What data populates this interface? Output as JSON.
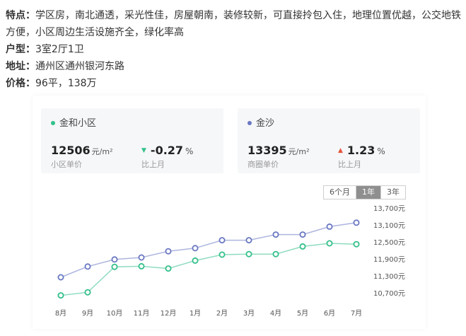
{
  "info": {
    "features_key": "特点：",
    "features_value": "学区房，南北通透，采光性佳，房屋朝南，装修较新，可直接拎包入住，地理位置优越，公交地铁方便，小区周边生活设施齐全，绿化率高",
    "layout_key": "户型：",
    "layout_value": "3室2厅1卫",
    "address_key": "地址：",
    "address_value": "通州区通州银河东路",
    "price_key": "价格：",
    "price_value": "96平，138万"
  },
  "colors": {
    "community": "#33c08a",
    "district": "#6a78c2",
    "down": "#33c08a",
    "up": "#e4553c"
  },
  "community_card": {
    "name": "金和小区",
    "price": "12506",
    "unit": "元/m²",
    "price_label": "小区单价",
    "change_value": "-0.27",
    "change_unit": "%",
    "change_label": "比上月",
    "arrow": "▼"
  },
  "district_card": {
    "name": "金沙",
    "price": "13395",
    "unit": "元/m²",
    "price_label": "商圈单价",
    "change_value": "1.23",
    "change_unit": "%",
    "change_label": "比上月",
    "arrow": "▲"
  },
  "tabs": [
    {
      "label": "6个月",
      "active": false
    },
    {
      "label": "1年",
      "active": true
    },
    {
      "label": "3年",
      "active": false
    }
  ],
  "chart_data": {
    "type": "line",
    "categories": [
      "8月",
      "9月",
      "10月",
      "11月",
      "12月",
      "1月",
      "2月",
      "3月",
      "4月",
      "5月",
      "6月",
      "7月"
    ],
    "ylim": [
      10400,
      13900
    ],
    "yticks": [
      10700,
      11300,
      11900,
      12500,
      13100,
      13700
    ],
    "ytick_labels": [
      "10,700元",
      "11,300元",
      "11,900元",
      "12,500元",
      "13,100元",
      "13,700元"
    ],
    "series": [
      {
        "color": "#6a78c2",
        "values": [
          11250,
          11630,
          11880,
          11950,
          12170,
          12280,
          12560,
          12560,
          12760,
          12760,
          13040,
          13180
        ]
      },
      {
        "color": "#33c08a",
        "values": [
          10610,
          10720,
          11620,
          11640,
          11560,
          11840,
          12050,
          12070,
          12070,
          12340,
          12450,
          12420
        ]
      }
    ]
  }
}
